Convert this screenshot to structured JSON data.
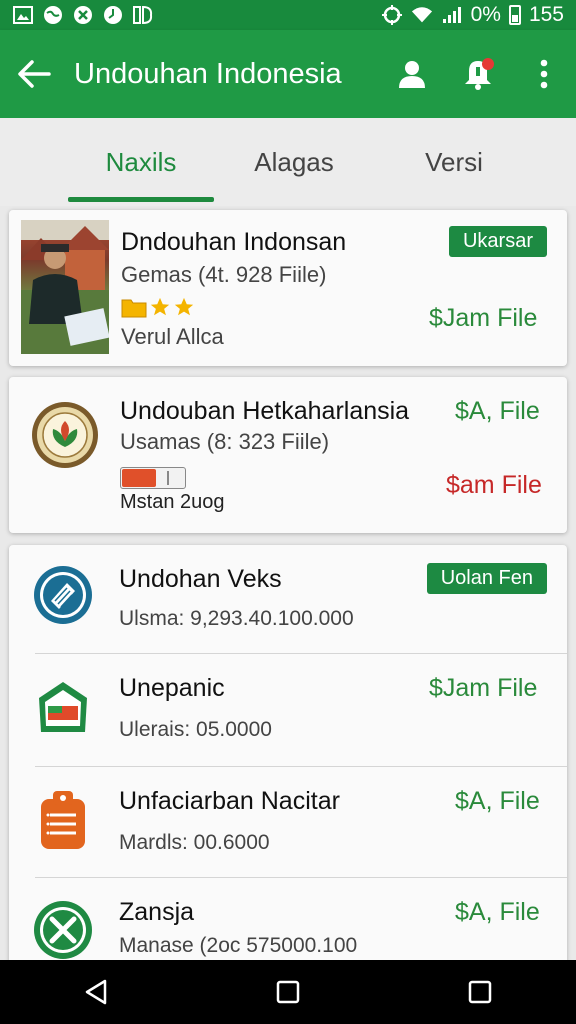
{
  "status_bar": {
    "battery_text": "0%",
    "time": "155"
  },
  "app_bar": {
    "title": "Undouhan Indonesia"
  },
  "tabs": [
    {
      "label": "Naxils",
      "active": true
    },
    {
      "label": "Alagas",
      "active": false
    },
    {
      "label": "Versi",
      "active": false
    }
  ],
  "cards": [
    {
      "name": "Dndouhan Indonsan",
      "sub": "Gemas (4t. 928 Fiile)",
      "publisher": "Verul Allca",
      "badge": "Ukarsar",
      "price": "$Jam File",
      "rating": 3
    },
    {
      "name": "Undouban Hetkaharlansia",
      "sub": "Usamas (8:  323 Fiile)",
      "publisher": "Mstan 2uog",
      "price_top": "$A, File",
      "price_bottom": "$am File"
    }
  ],
  "list_items": [
    {
      "name": "Undohan Veks",
      "sub": "Ulsma: 9,293.40.100.000",
      "badge": "Uolan Fen"
    },
    {
      "name": "Unepanic",
      "sub": "Ulerais: 05.0000",
      "price": "$Jam File"
    },
    {
      "name": "Unfaciarban Nacitar",
      "sub": "Mardls: 00.6000",
      "price": "$A, File"
    },
    {
      "name": "Zansja",
      "sub": "Manase (2oc 575000.100",
      "price": "$A, File"
    }
  ],
  "colors": {
    "primary": "#1f9a45",
    "status_bar": "#188a3d",
    "price_green": "#2a8a3b",
    "price_red": "#c62828"
  },
  "icons": {
    "back": "arrow-left-icon",
    "profile": "person-icon",
    "notifications": "bell-icon",
    "menu": "more-vert-icon"
  }
}
